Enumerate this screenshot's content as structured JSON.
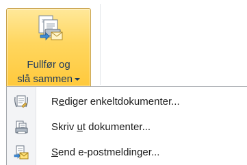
{
  "ribbon": {
    "button": {
      "label_line1": "Fullfør og",
      "label_line2": "slå sammen",
      "icon": "finish-merge-icon",
      "state": "pressed"
    }
  },
  "menu": {
    "items": [
      {
        "label": "Rediger enkeltdokumenter...",
        "mnemonic": "e",
        "icon": "edit-individual-documents-icon"
      },
      {
        "label": "Skriv ut dokumenter...",
        "mnemonic": "u",
        "icon": "print-documents-icon"
      },
      {
        "label": "Send e-postmeldinger...",
        "mnemonic": "S",
        "icon": "send-email-icon"
      }
    ]
  },
  "colors": {
    "pressed_top": "#ffe89a",
    "pressed_bottom": "#ffc93c",
    "label_text": "#1e395b",
    "menu_border": "#a7abb0"
  }
}
